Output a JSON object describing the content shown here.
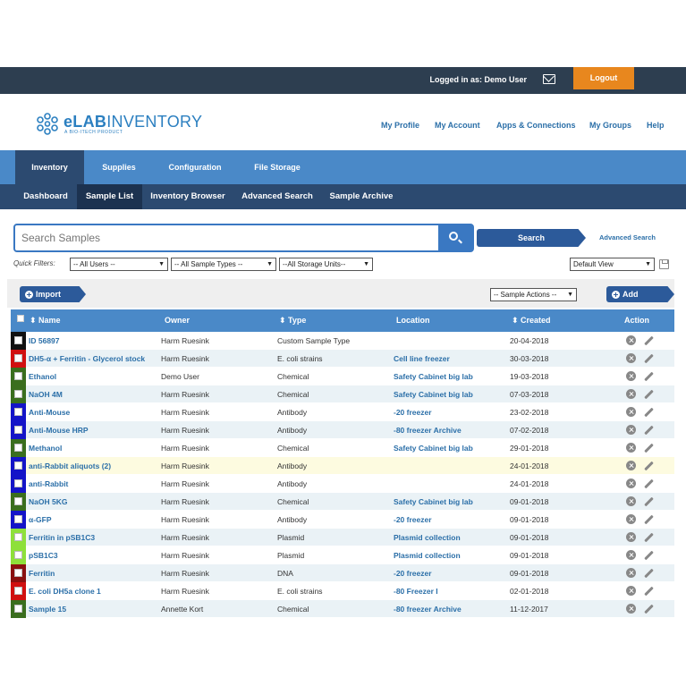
{
  "topbar": {
    "logged_in": "Logged in as: Demo User",
    "logout": "Logout"
  },
  "header": {
    "logo_bold": "eLAB",
    "logo_light": "INVENTORY",
    "logo_sub": "A BIO-ITECH PRODUCT",
    "links": [
      "My Profile",
      "My Account",
      "Apps & Connections",
      "My Groups",
      "Help"
    ]
  },
  "nav_primary": [
    "Inventory",
    "Supplies",
    "Configuration",
    "File Storage"
  ],
  "nav_secondary": [
    "Dashboard",
    "Sample List",
    "Inventory Browser",
    "Advanced Search",
    "Sample Archive"
  ],
  "search": {
    "placeholder": "Search Samples",
    "button": "Search",
    "advanced": "Advanced Search"
  },
  "filters": {
    "label": "Quick Filters:",
    "users": "-- All Users --",
    "sample_types": "-- All Sample Types --",
    "storage_units": "--All Storage Units--",
    "view": "Default View"
  },
  "toolbar": {
    "import": "Import",
    "sample_actions": "-- Sample Actions --",
    "add": "Add"
  },
  "table": {
    "headers": {
      "name": "⬍ Name",
      "owner": "Owner",
      "type": "⬍ Type",
      "location": "Location",
      "created": "⬍ Created",
      "action": "Action"
    },
    "rows": [
      {
        "name": "ID 56897",
        "owner": "Harm Ruesink",
        "type": "Custom Sample Type",
        "location": "",
        "created": "20-04-2018",
        "color": "#111111"
      },
      {
        "name": "DH5-α + Ferritin - Glycerol stock",
        "owner": "Harm Ruesink",
        "type": "E. coli strains",
        "location": "Cell line freezer",
        "created": "30-03-2018",
        "color": "#d01010"
      },
      {
        "name": "Ethanol",
        "owner": "Demo User",
        "type": "Chemical",
        "location": "Safety Cabinet big lab",
        "created": "19-03-2018",
        "color": "#3a6e1e"
      },
      {
        "name": "NaOH 4M",
        "owner": "Harm Ruesink",
        "type": "Chemical",
        "location": "Safety Cabinet big lab",
        "created": "07-03-2018",
        "color": "#3a6e1e"
      },
      {
        "name": "Anti-Mouse",
        "owner": "Harm Ruesink",
        "type": "Antibody",
        "location": "-20 freezer",
        "created": "23-02-2018",
        "color": "#1414c8"
      },
      {
        "name": "Anti-Mouse HRP",
        "owner": "Harm Ruesink",
        "type": "Antibody",
        "location": "-80 freezer Archive",
        "created": "07-02-2018",
        "color": "#1414c8"
      },
      {
        "name": "Methanol",
        "owner": "Harm Ruesink",
        "type": "Chemical",
        "location": "Safety Cabinet big lab",
        "created": "29-01-2018",
        "color": "#3a6e1e"
      },
      {
        "name": "anti-Rabbit aliquots (2)",
        "owner": "Harm Ruesink",
        "type": "Antibody",
        "location": "",
        "created": "24-01-2018",
        "color": "#1414c8"
      },
      {
        "name": "anti-Rabbit",
        "owner": "Harm Ruesink",
        "type": "Antibody",
        "location": "",
        "created": "24-01-2018",
        "color": "#1414c8"
      },
      {
        "name": "NaOH 5KG",
        "owner": "Harm Ruesink",
        "type": "Chemical",
        "location": "Safety Cabinet big lab",
        "created": "09-01-2018",
        "color": "#3a6e1e"
      },
      {
        "name": "α-GFP",
        "owner": "Harm Ruesink",
        "type": "Antibody",
        "location": "-20 freezer",
        "created": "09-01-2018",
        "color": "#1414c8"
      },
      {
        "name": "Ferritin in pSB1C3",
        "owner": "Harm Ruesink",
        "type": "Plasmid",
        "location": "Plasmid collection",
        "created": "09-01-2018",
        "color": "#8ee03a"
      },
      {
        "name": "pSB1C3",
        "owner": "Harm Ruesink",
        "type": "Plasmid",
        "location": "Plasmid collection",
        "created": "09-01-2018",
        "color": "#8ee03a"
      },
      {
        "name": "Ferritin",
        "owner": "Harm Ruesink",
        "type": "DNA",
        "location": "-20 freezer",
        "created": "09-01-2018",
        "color": "#8a1010"
      },
      {
        "name": "E. coli DH5a clone 1",
        "owner": "Harm Ruesink",
        "type": "E. coli strains",
        "location": "-80 Freezer I",
        "created": "02-01-2018",
        "color": "#d01010"
      },
      {
        "name": "Sample 15",
        "owner": "Annette Kort",
        "type": "Chemical",
        "location": "-80 freezer Archive",
        "created": "11-12-2017",
        "color": "#3a6e1e"
      }
    ]
  }
}
